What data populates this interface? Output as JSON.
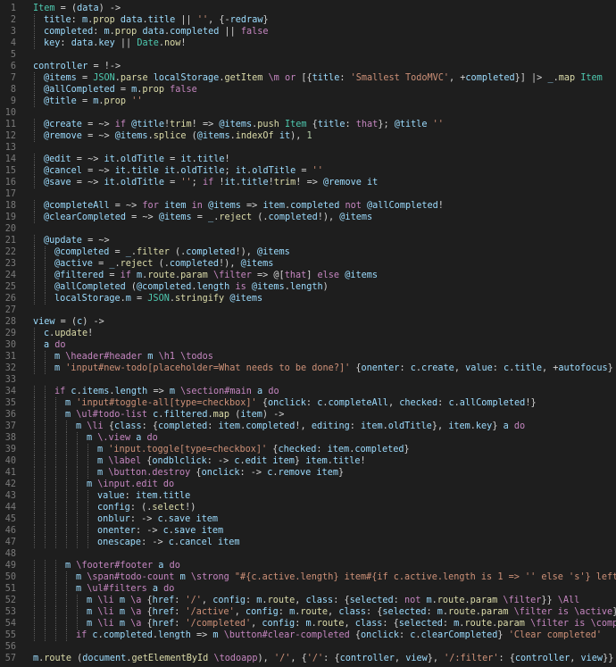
{
  "editor": {
    "lines": [
      {
        "n": "1",
        "indent": 0,
        "text": "Item = (data) ->"
      },
      {
        "n": "2",
        "indent": 1,
        "text": "title: m.prop data.title || '', {-redraw}"
      },
      {
        "n": "3",
        "indent": 1,
        "text": "completed: m.prop data.completed || false"
      },
      {
        "n": "4",
        "indent": 1,
        "text": "key: data.key || Date.now!"
      },
      {
        "n": "5",
        "indent": 0,
        "text": ""
      },
      {
        "n": "6",
        "indent": 0,
        "text": "controller = !->"
      },
      {
        "n": "7",
        "indent": 1,
        "text": "@items = JSON.parse localStorage.getItem \\m or [{title: 'Smallest TodoMVC', +completed}] |> _.map Item"
      },
      {
        "n": "8",
        "indent": 1,
        "text": "@allCompleted = m.prop false"
      },
      {
        "n": "9",
        "indent": 1,
        "text": "@title = m.prop ''"
      },
      {
        "n": "10",
        "indent": 0,
        "text": ""
      },
      {
        "n": "11",
        "indent": 1,
        "text": "@create = ~> if @title!trim! => @items.push Item {title: that}; @title ''"
      },
      {
        "n": "12",
        "indent": 1,
        "text": "@remove = ~> @items.splice (@items.indexOf it), 1"
      },
      {
        "n": "13",
        "indent": 0,
        "text": ""
      },
      {
        "n": "14",
        "indent": 1,
        "text": "@edit = ~> it.oldTitle = it.title!"
      },
      {
        "n": "15",
        "indent": 1,
        "text": "@cancel = ~> it.title it.oldTitle; it.oldTitle = ''"
      },
      {
        "n": "16",
        "indent": 1,
        "text": "@save = ~> it.oldTitle = ''; if !it.title!trim! => @remove it"
      },
      {
        "n": "17",
        "indent": 0,
        "text": ""
      },
      {
        "n": "18",
        "indent": 1,
        "text": "@completeAll = ~> for item in @items => item.completed not @allCompleted!"
      },
      {
        "n": "19",
        "indent": 1,
        "text": "@clearCompleted = ~> @items = _.reject (.completed!), @items"
      },
      {
        "n": "20",
        "indent": 0,
        "text": ""
      },
      {
        "n": "21",
        "indent": 1,
        "text": "@update = ~>"
      },
      {
        "n": "22",
        "indent": 2,
        "text": "@completed = _.filter (.completed!), @items"
      },
      {
        "n": "23",
        "indent": 2,
        "text": "@active = _.reject (.completed!), @items"
      },
      {
        "n": "24",
        "indent": 2,
        "text": "@filtered = if m.route.param \\filter => @[that] else @items"
      },
      {
        "n": "25",
        "indent": 2,
        "text": "@allCompleted (@completed.length is @items.length)"
      },
      {
        "n": "26",
        "indent": 2,
        "text": "localStorage.m = JSON.stringify @items"
      },
      {
        "n": "27",
        "indent": 0,
        "text": ""
      },
      {
        "n": "28",
        "indent": 0,
        "text": "view = (c) ->"
      },
      {
        "n": "29",
        "indent": 1,
        "text": "c.update!"
      },
      {
        "n": "30",
        "indent": 1,
        "text": "a do"
      },
      {
        "n": "31",
        "indent": 2,
        "text": "m \\header#header m \\h1 \\todos"
      },
      {
        "n": "32",
        "indent": 2,
        "text": "m 'input#new-todo[placeholder=What needs to be done?]' {onenter: c.create, value: c.title, +autofocus}"
      },
      {
        "n": "33",
        "indent": 0,
        "text": ""
      },
      {
        "n": "34",
        "indent": 2,
        "text": "if c.items.length => m \\section#main a do"
      },
      {
        "n": "35",
        "indent": 3,
        "text": "m 'input#toggle-all[type=checkbox]' {onclick: c.completeAll, checked: c.allCompleted!}"
      },
      {
        "n": "36",
        "indent": 3,
        "text": "m \\ul#todo-list c.filtered.map (item) ->"
      },
      {
        "n": "37",
        "indent": 4,
        "text": "m \\li {class: {completed: item.completed!, editing: item.oldTitle}, item.key} a do"
      },
      {
        "n": "38",
        "indent": 5,
        "text": "m \\.view a do"
      },
      {
        "n": "39",
        "indent": 6,
        "text": "m 'input.toggle[type=checkbox]' {checked: item.completed}"
      },
      {
        "n": "40",
        "indent": 6,
        "text": "m \\label {ondblclick: -> c.edit item} item.title!"
      },
      {
        "n": "41",
        "indent": 6,
        "text": "m \\button.destroy {onclick: -> c.remove item}"
      },
      {
        "n": "42",
        "indent": 5,
        "text": "m \\input.edit do"
      },
      {
        "n": "43",
        "indent": 6,
        "text": "value: item.title"
      },
      {
        "n": "44",
        "indent": 6,
        "text": "config: (.select!)"
      },
      {
        "n": "45",
        "indent": 6,
        "text": "onblur: -> c.save item"
      },
      {
        "n": "46",
        "indent": 6,
        "text": "onenter: -> c.save item"
      },
      {
        "n": "47",
        "indent": 6,
        "text": "onescape: -> c.cancel item"
      },
      {
        "n": "48",
        "indent": 0,
        "text": ""
      },
      {
        "n": "49",
        "indent": 3,
        "text": "m \\footer#footer a do"
      },
      {
        "n": "50",
        "indent": 4,
        "text": "m \\span#todo-count m \\strong \"#{c.active.length} item#{if c.active.length is 1 => '' else 's'} left\""
      },
      {
        "n": "51",
        "indent": 4,
        "text": "m \\ul#filters a do"
      },
      {
        "n": "52",
        "indent": 5,
        "text": "m \\li m \\a {href: '/', config: m.route, class: {selected: not m.route.param \\filter}} \\All"
      },
      {
        "n": "53",
        "indent": 5,
        "text": "m \\li m \\a {href: '/active', config: m.route, class: {selected: m.route.param \\filter is \\active}} \\Active"
      },
      {
        "n": "54",
        "indent": 5,
        "text": "m \\li m \\a {href: '/completed', config: m.route, class: {selected: m.route.param \\filter is \\completed}} \\Completed"
      },
      {
        "n": "55",
        "indent": 4,
        "text": "if c.completed.length => m \\button#clear-completed {onclick: c.clearCompleted} 'Clear completed'"
      },
      {
        "n": "56",
        "indent": 0,
        "text": ""
      },
      {
        "n": "57",
        "indent": 0,
        "text": "m.route (document.getElementById \\todoapp), '/', {'/': {controller, view}, '/:filter': {controller, view}}"
      }
    ]
  },
  "colors": {
    "background": "#1e1e1e",
    "line_number": "#7a7a7a",
    "default": "#d4d4d4",
    "keyword": "#c586c0",
    "identifier": "#9cdcfe",
    "function": "#dcdcaa",
    "type": "#4ec9b0",
    "string": "#ce9178",
    "number": "#b5cea8",
    "self": "#9cdcfe",
    "operator": "#d4d4d4",
    "symbol": "#c586c0"
  }
}
